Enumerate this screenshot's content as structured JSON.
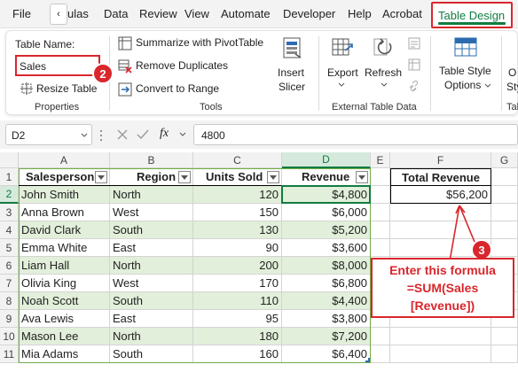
{
  "menu": {
    "file": "File",
    "back": "‹",
    "formulas": "ulas",
    "data": "Data",
    "review": "Review",
    "view": "View",
    "automate": "Automate",
    "developer": "Developer",
    "help": "Help",
    "acrobat": "Acrobat",
    "table_design": "Table Design"
  },
  "badges": {
    "one": "1",
    "two": "2",
    "three": "3"
  },
  "ribbon": {
    "table_name_label": "Table Name:",
    "table_name_value": "Sales",
    "resize_table": "Resize Table",
    "properties": "Properties",
    "summarize": "Summarize with PivotTable",
    "remove_duplicates": "Remove Duplicates",
    "convert_to_range": "Convert to Range",
    "tools": "Tools",
    "insert": "Insert",
    "slicer": "Slicer",
    "export": "Export",
    "refresh": "Refresh",
    "external_table_data": "External Table Data",
    "table_style": "Table Style",
    "options": "Options",
    "cut_o": "O",
    "cut_sty": "Sty",
    "cut_tab": "Tab"
  },
  "formula_bar": {
    "name_box": "D2",
    "fx": "fx",
    "formula": "4800"
  },
  "sheet": {
    "columns": [
      "A",
      "B",
      "C",
      "D",
      "E",
      "F",
      "G"
    ],
    "rows": [
      "1",
      "2",
      "3",
      "4",
      "5",
      "6",
      "7",
      "8",
      "9",
      "10",
      "11"
    ],
    "headers": {
      "salesperson": "Salesperson",
      "region": "Region",
      "units_sold": "Units Sold",
      "revenue": "Revenue"
    },
    "total_header": "Total Revenue",
    "total_value": "$56,200",
    "data": [
      {
        "salesperson": "John Smith",
        "region": "North",
        "units": "120",
        "revenue": "$4,800"
      },
      {
        "salesperson": "Anna Brown",
        "region": "West",
        "units": "150",
        "revenue": "$6,000"
      },
      {
        "salesperson": "David Clark",
        "region": "South",
        "units": "130",
        "revenue": "$5,200"
      },
      {
        "salesperson": "Emma White",
        "region": "East",
        "units": "90",
        "revenue": "$3,600"
      },
      {
        "salesperson": "Liam Hall",
        "region": "North",
        "units": "200",
        "revenue": "$8,000"
      },
      {
        "salesperson": "Olivia King",
        "region": "West",
        "units": "170",
        "revenue": "$6,800"
      },
      {
        "salesperson": "Noah Scott",
        "region": "South",
        "units": "110",
        "revenue": "$4,400"
      },
      {
        "salesperson": "Ava Lewis",
        "region": "East",
        "units": "95",
        "revenue": "$3,800"
      },
      {
        "salesperson": "Mason Lee",
        "region": "North",
        "units": "180",
        "revenue": "$7,200"
      },
      {
        "salesperson": "Mia Adams",
        "region": "South",
        "units": "160",
        "revenue": "$6,400"
      }
    ]
  },
  "annotation": {
    "line1": "Enter this formula",
    "line2": "=SUM(Sales",
    "line3": "[Revenue])"
  },
  "colors": {
    "accent_green": "#107c41",
    "band_green": "#e2efda",
    "highlight_red": "#d9262c",
    "table_border": "#70ad47"
  }
}
